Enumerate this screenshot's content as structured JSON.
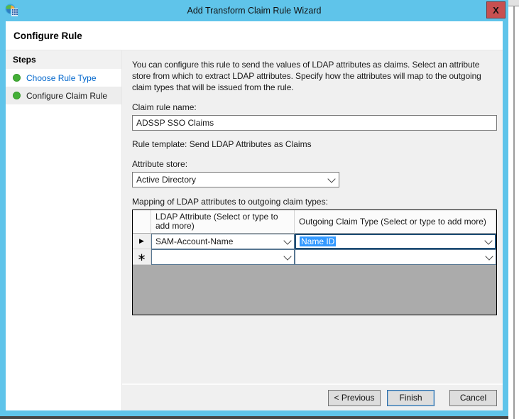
{
  "window": {
    "title": "Add Transform Claim Rule Wizard",
    "close_glyph": "X"
  },
  "header": {
    "title": "Configure Rule"
  },
  "sidebar": {
    "title": "Steps",
    "items": [
      {
        "label": "Choose Rule Type",
        "state": "completed-link"
      },
      {
        "label": "Configure Claim Rule",
        "state": "current"
      }
    ]
  },
  "main": {
    "description": "You can configure this rule to send the values of LDAP attributes as claims. Select an attribute store from which to extract LDAP attributes. Specify how the attributes will map to the outgoing claim types that will be issued from the rule.",
    "claim_rule_name": {
      "label": "Claim rule name:",
      "value": "ADSSP SSO Claims"
    },
    "rule_template": "Rule template: Send LDAP Attributes as Claims",
    "attribute_store": {
      "label": "Attribute store:",
      "value": "Active Directory"
    },
    "mapping_label": "Mapping of LDAP attributes to outgoing claim types:",
    "grid": {
      "columns": [
        "",
        "LDAP Attribute (Select or type to add more)",
        "Outgoing Claim Type (Select or type to add more)"
      ],
      "rows": [
        {
          "ldap_attribute": "SAM-Account-Name",
          "outgoing_claim_type": "Name ID",
          "selected_cell": "outgoing_claim_type"
        },
        {
          "ldap_attribute": "",
          "outgoing_claim_type": ""
        }
      ]
    }
  },
  "icons": {
    "current_row": "▶",
    "new_row": "∗"
  },
  "footer": {
    "buttons": [
      {
        "label": "< Previous",
        "focused": false
      },
      {
        "label": "Finish",
        "focused": true
      },
      {
        "label": "Cancel",
        "focused": false
      }
    ]
  },
  "colors": {
    "titlebar_blue": "#5fc4ea",
    "close_button_red": "#c75050",
    "selection_blue": "#3399ff",
    "step_bullet_green": "#44af37",
    "link_blue": "#0066cc",
    "grid_empty_gray": "#ababab"
  }
}
